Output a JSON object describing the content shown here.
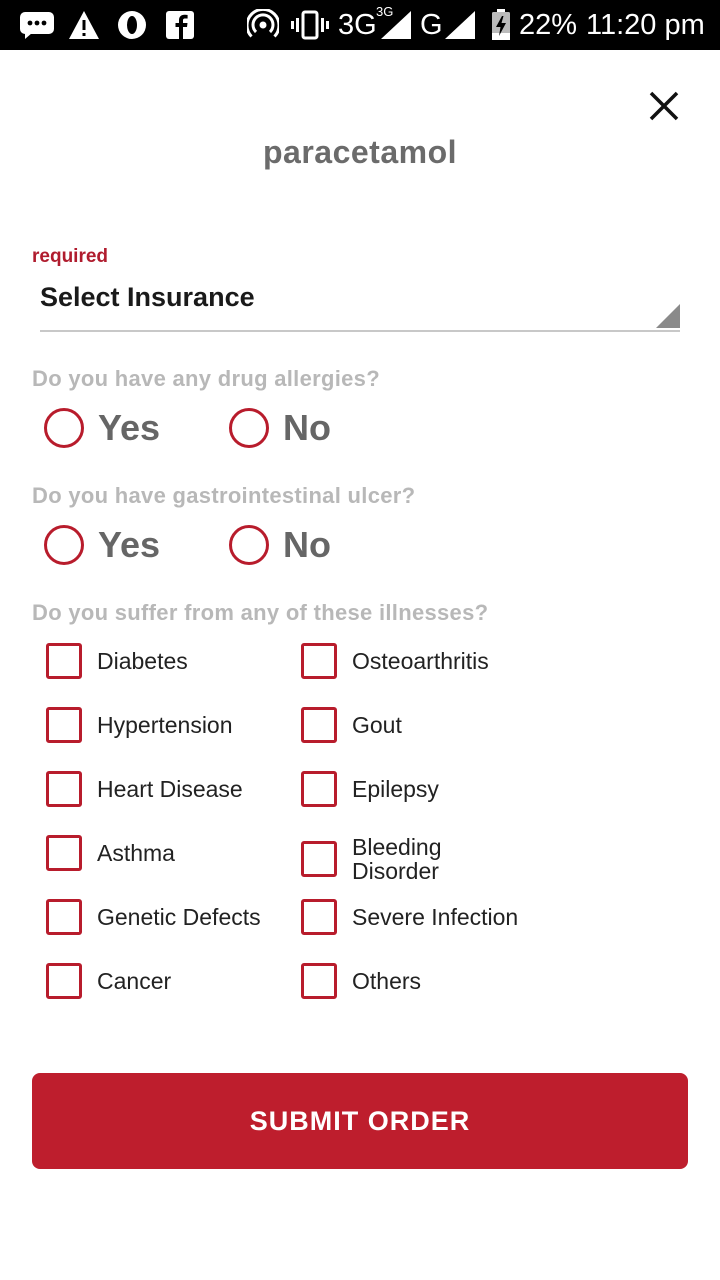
{
  "status_bar": {
    "network_3g": "3G",
    "network_3g_sup": "3G",
    "network_g": "G",
    "battery": "22%",
    "time": "11:20 pm",
    "icons": [
      "chat-icon",
      "warning-icon",
      "opera-icon",
      "facebook-icon",
      "hotspot-icon",
      "vibrate-icon",
      "signal-icon",
      "battery-charging-icon"
    ]
  },
  "sheet": {
    "title": "paracetamol",
    "close_icon": "close-icon"
  },
  "insurance": {
    "required_label": "required",
    "selected_value": "Select Insurance"
  },
  "questions": {
    "allergies": {
      "label": "Do you have any drug allergies?",
      "options": [
        "Yes",
        "No"
      ]
    },
    "ulcer": {
      "label": "Do you have gastrointestinal ulcer?",
      "options": [
        "Yes",
        "No"
      ]
    },
    "illnesses": {
      "label": "Do you suffer from any of these illnesses?",
      "left": [
        "Diabetes",
        "Hypertension",
        "Heart Disease",
        "Asthma",
        "Genetic Defects",
        "Cancer"
      ],
      "right": [
        "Osteoarthritis",
        "Gout",
        "Epilepsy",
        "Bleeding\nDisorder",
        "Severe Infection",
        "Others"
      ]
    }
  },
  "submit": {
    "label": "SUBMIT ORDER"
  },
  "colors": {
    "accent": "#be1e2d",
    "question_text": "#b8b8b8",
    "title_text": "#6b6b6b"
  }
}
